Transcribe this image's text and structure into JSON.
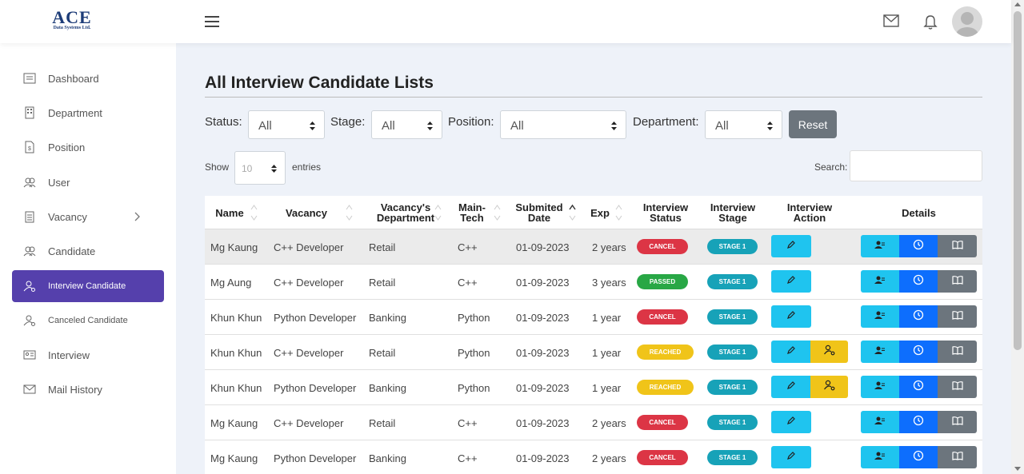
{
  "logo": {
    "main": "ACE",
    "sub": "Data Systems Ltd."
  },
  "sidebar": {
    "items": [
      {
        "label": "Dashboard",
        "icon": "dashboard-icon"
      },
      {
        "label": "Department",
        "icon": "building-icon"
      },
      {
        "label": "Position",
        "icon": "document-icon"
      },
      {
        "label": "User",
        "icon": "users-icon"
      },
      {
        "label": "Vacancy",
        "icon": "clipboard-icon"
      },
      {
        "label": "Candidate",
        "icon": "users-icon"
      },
      {
        "label": "Interview Candidate",
        "icon": "user-settings-icon"
      },
      {
        "label": "Canceled Candidate",
        "icon": "user-settings-icon"
      },
      {
        "label": "Interview",
        "icon": "id-card-icon"
      },
      {
        "label": "Mail History",
        "icon": "mail-icon"
      }
    ]
  },
  "page": {
    "title": "All Interview Candidate Lists"
  },
  "filters": {
    "status_label": "Status:",
    "status_value": "All",
    "stage_label": "Stage:",
    "stage_value": "All",
    "position_label": "Position:",
    "position_value": "All",
    "department_label": "Department:",
    "department_value": "All",
    "reset_label": "Reset"
  },
  "entries": {
    "show_label": "Show",
    "value": "10",
    "suffix": "entries"
  },
  "search": {
    "label": "Search:"
  },
  "table": {
    "headers": {
      "name": "Name",
      "vacancy": "Vacancy",
      "vacancy_dept_1": "Vacancy's",
      "vacancy_dept_2": "Department",
      "main_tech_1": "Main-",
      "main_tech_2": "Tech",
      "submitted_1": "Submited",
      "submitted_2": "Date",
      "exp": "Exp",
      "int_status_1": "Interview",
      "int_status_2": "Status",
      "int_stage_1": "Interview",
      "int_stage_2": "Stage",
      "int_action_1": "Interview",
      "int_action_2": "Action",
      "details": "Details"
    },
    "rows": [
      {
        "name": "Mg Kaung",
        "vacancy": "C++ Developer",
        "department": "Retail",
        "tech": "C++",
        "date": "01-09-2023",
        "exp": "2 years",
        "status": "CANCEL",
        "stage": "STAGE 1"
      },
      {
        "name": "Mg Aung",
        "vacancy": "C++ Developer",
        "department": "Retail",
        "tech": "C++",
        "date": "01-09-2023",
        "exp": "3 years",
        "status": "PASSED",
        "stage": "STAGE 1"
      },
      {
        "name": "Khun Khun",
        "vacancy": "Python Developer",
        "department": "Banking",
        "tech": "Python",
        "date": "01-09-2023",
        "exp": "1 year",
        "status": "CANCEL",
        "stage": "STAGE 1"
      },
      {
        "name": "Khun Khun",
        "vacancy": "C++ Developer",
        "department": "Retail",
        "tech": "Python",
        "date": "01-09-2023",
        "exp": "1 year",
        "status": "REACHED",
        "stage": "STAGE 1"
      },
      {
        "name": "Khun Khun",
        "vacancy": "Python Developer",
        "department": "Banking",
        "tech": "Python",
        "date": "01-09-2023",
        "exp": "1 year",
        "status": "REACHED",
        "stage": "STAGE 1"
      },
      {
        "name": "Mg Kaung",
        "vacancy": "C++ Developer",
        "department": "Retail",
        "tech": "C++",
        "date": "01-09-2023",
        "exp": "2 years",
        "status": "CANCEL",
        "stage": "STAGE 1"
      },
      {
        "name": "Mg Kaung",
        "vacancy": "Python Developer",
        "department": "Banking",
        "tech": "C++",
        "date": "01-09-2023",
        "exp": "2 years",
        "status": "CANCEL",
        "stage": "STAGE 1"
      }
    ]
  },
  "colors": {
    "accent": "#5540ac",
    "cancel": "#dc3545",
    "passed": "#28a745",
    "reached": "#f0c419",
    "stage": "#17a2b8",
    "edit": "#1fc4ef",
    "info": "#0d6efd",
    "secondary": "#6c757d"
  }
}
